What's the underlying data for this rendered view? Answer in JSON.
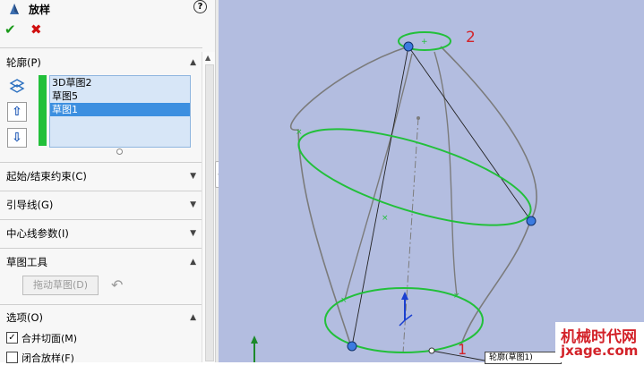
{
  "panel": {
    "title": "放样",
    "help_icon": "question-icon",
    "ok_icon": "check-icon",
    "cancel_icon": "close-icon",
    "ok_glyph": "✔",
    "cancel_glyph": "✖",
    "help_glyph": "?"
  },
  "sections": {
    "profile": "轮廓(P)",
    "start_end": "起始/结束约束(C)",
    "guides": "引导线(G)",
    "centerline": "中心线参数(I)",
    "sketch_tools": "草图工具",
    "options": "选项(O)"
  },
  "profile_list": {
    "items": [
      "3D草图2",
      "草图5",
      "草图1"
    ],
    "selected": "草图1"
  },
  "buttons": {
    "move_up": "⇧",
    "move_down": "⇩",
    "drag_sketch": "拖动草图(D)",
    "undo_glyph": "↶"
  },
  "options": {
    "merge_tangent_faces": {
      "label": "合并切面(M)",
      "checked": true
    },
    "close_loft": {
      "label": "闭合放样(F)",
      "checked": false
    }
  },
  "viewport": {
    "label_1": "1",
    "label_2": "2",
    "callout": "轮廓(草图1)"
  },
  "watermark": {
    "line1": "机械时代网",
    "line2": "jxage.com"
  },
  "colors": {
    "viewport_bg": "#b3bde0",
    "sketch_green": "#22c03a",
    "point_blue": "#3c7be0",
    "accent_red": "#d3232a"
  }
}
